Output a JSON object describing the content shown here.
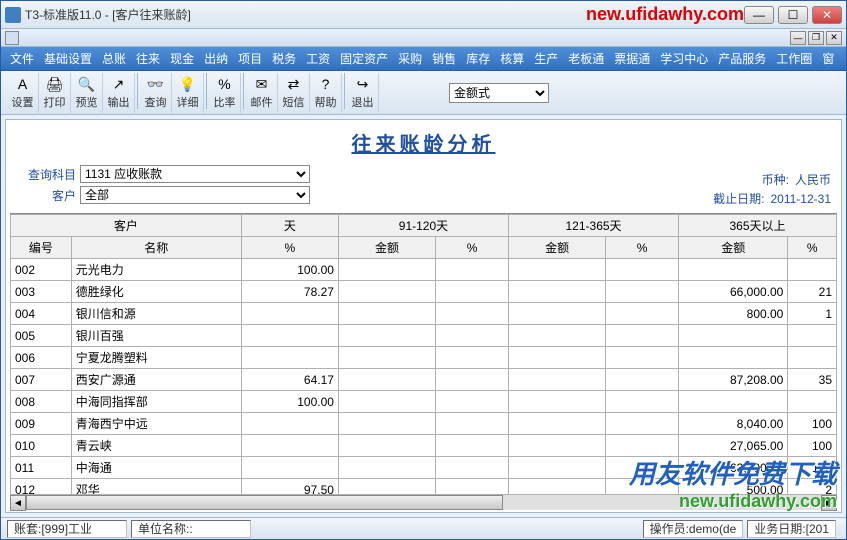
{
  "window": {
    "title": "T3-标准版11.0 - [客户往来账龄]",
    "watermark_top": "new.ufidawhy.com"
  },
  "menu": [
    "文件",
    "基础设置",
    "总账",
    "往来",
    "现金",
    "出纳",
    "项目",
    "税务",
    "工资",
    "固定资产",
    "采购",
    "销售",
    "库存",
    "核算",
    "生产",
    "老板通",
    "票据通",
    "学习中心",
    "产品服务",
    "工作圈",
    "窗"
  ],
  "toolbar": {
    "buttons": [
      {
        "label": "设置",
        "icon": "A"
      },
      {
        "label": "打印",
        "icon": "🖨"
      },
      {
        "label": "预览",
        "icon": "🔍"
      },
      {
        "label": "输出",
        "icon": "↗"
      },
      {
        "label": "查询",
        "icon": "👓"
      },
      {
        "label": "详细",
        "icon": "💡"
      },
      {
        "label": "比率",
        "icon": "%"
      },
      {
        "label": "邮件",
        "icon": "✉"
      },
      {
        "label": "短信",
        "icon": "⇄"
      },
      {
        "label": "帮助",
        "icon": "?"
      },
      {
        "label": "退出",
        "icon": "↪"
      }
    ],
    "display_mode_label": "金额式"
  },
  "report": {
    "title": "往来账龄分析",
    "filter_subject_label": "查询科目",
    "filter_subject_value": "1131 应收账款",
    "filter_customer_label": "客户",
    "filter_customer_value": "全部",
    "currency_label": "币种:",
    "currency_value": "人民币",
    "cutoff_label": "截止日期:",
    "cutoff_value": "2011-12-31"
  },
  "grid": {
    "group_headers": [
      "客户",
      "天",
      "91-120天",
      "121-365天",
      "365天以上"
    ],
    "sub_headers": [
      "编号",
      "名称",
      "%",
      "金额",
      "%",
      "金额",
      "%",
      "金额",
      "%"
    ],
    "rows": [
      {
        "code": "002",
        "name": "元光电力",
        "pct": "100.00",
        "a1": "",
        "p1": "",
        "a2": "",
        "p2": "",
        "a3": "",
        "p3": ""
      },
      {
        "code": "003",
        "name": "德胜绿化",
        "pct": "78.27",
        "a1": "",
        "p1": "",
        "a2": "",
        "p2": "",
        "a3": "66,000.00",
        "p3": "21"
      },
      {
        "code": "004",
        "name": "银川信和源",
        "pct": "",
        "a1": "",
        "p1": "",
        "a2": "",
        "p2": "",
        "a3": "800.00",
        "p3": "1"
      },
      {
        "code": "005",
        "name": "银川百强",
        "pct": "",
        "a1": "",
        "p1": "",
        "a2": "",
        "p2": "",
        "a3": "",
        "p3": ""
      },
      {
        "code": "006",
        "name": "宁夏龙腾塑料",
        "pct": "",
        "a1": "",
        "p1": "",
        "a2": "",
        "p2": "",
        "a3": "",
        "p3": ""
      },
      {
        "code": "007",
        "name": "西安广源通",
        "pct": "64.17",
        "a1": "",
        "p1": "",
        "a2": "",
        "p2": "",
        "a3": "87,208.00",
        "p3": "35"
      },
      {
        "code": "008",
        "name": "中海同指挥部",
        "pct": "100.00",
        "a1": "",
        "p1": "",
        "a2": "",
        "p2": "",
        "a3": "",
        "p3": ""
      },
      {
        "code": "009",
        "name": "青海西宁中远",
        "pct": "",
        "a1": "",
        "p1": "",
        "a2": "",
        "p2": "",
        "a3": "8,040.00",
        "p3": "100"
      },
      {
        "code": "010",
        "name": "青云峡",
        "pct": "",
        "a1": "",
        "p1": "",
        "a2": "",
        "p2": "",
        "a3": "27,065.00",
        "p3": "100"
      },
      {
        "code": "011",
        "name": "中海通",
        "pct": "",
        "a1": "",
        "p1": "",
        "a2": "",
        "p2": "",
        "a3": "63,300.00",
        "p3": "100"
      },
      {
        "code": "012",
        "name": "邓华",
        "pct": "97.50",
        "a1": "",
        "p1": "",
        "a2": "",
        "p2": "",
        "a3": "500.00",
        "p3": "2"
      }
    ]
  },
  "status": {
    "account_set_label": "账套:",
    "account_set_value": "[999]工业",
    "company_label": "单位名称::",
    "company_value": "",
    "operator_label": "操作员:",
    "operator_value": "demo(de",
    "biz_date_label": "业务日期:",
    "biz_date_value": "[201"
  },
  "watermark_big": {
    "line1": "用友软件免费下载",
    "line2": "new.ufidawhy.com"
  }
}
